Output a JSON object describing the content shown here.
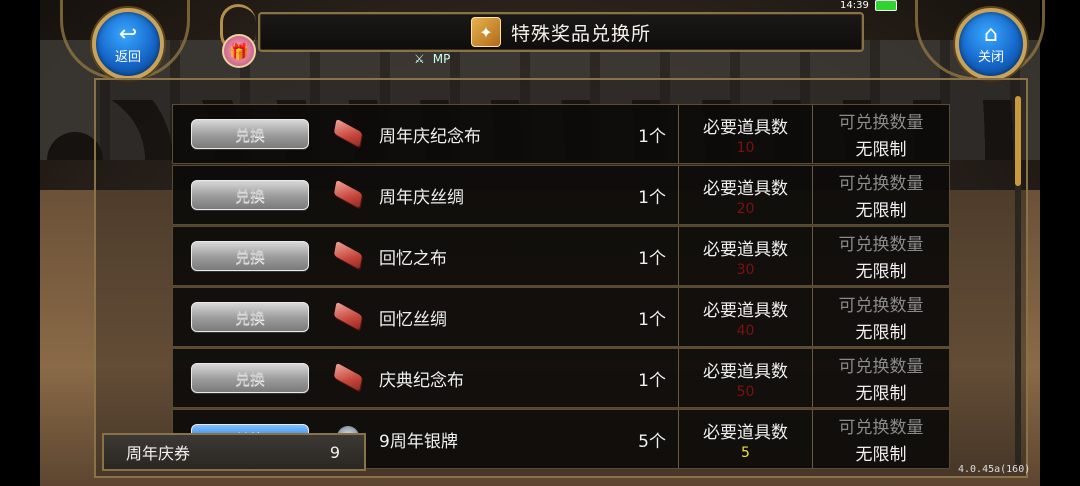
{
  "window": {
    "title": "特殊奖品兑换所"
  },
  "system": {
    "time": "14:39"
  },
  "nav": {
    "back_label": "返回",
    "close_label": "关闭"
  },
  "status": {
    "skill_label": "⚔",
    "mp_label": "MP"
  },
  "columns": {
    "required_label": "必要道具数",
    "limit_label": "可兑换数量"
  },
  "items": [
    {
      "button": "兑换",
      "name": "周年庆纪念布",
      "qty": "1个",
      "required": "10",
      "limit": "无限制",
      "affordable": false
    },
    {
      "button": "兑换",
      "name": "周年庆丝绸",
      "qty": "1个",
      "required": "20",
      "limit": "无限制",
      "affordable": false
    },
    {
      "button": "兑换",
      "name": "回忆之布",
      "qty": "1个",
      "required": "30",
      "limit": "无限制",
      "affordable": false
    },
    {
      "button": "兑换",
      "name": "回忆丝绸",
      "qty": "1个",
      "required": "40",
      "limit": "无限制",
      "affordable": false
    },
    {
      "button": "兑换",
      "name": "庆典纪念布",
      "qty": "1个",
      "required": "50",
      "limit": "无限制",
      "affordable": false
    },
    {
      "button": "兑换",
      "name": "9周年银牌",
      "qty": "5个",
      "required": "5",
      "limit": "无限制",
      "affordable": true
    }
  ],
  "currency": {
    "name": "周年庆券",
    "amount": "9"
  },
  "version": "4.0.45a(160)",
  "colors": {
    "accent_gold": "#8a7248",
    "button_blue": "#2d7fe0",
    "insufficient_red": "#7c1111",
    "sufficient_yellow": "#f1df3b"
  }
}
